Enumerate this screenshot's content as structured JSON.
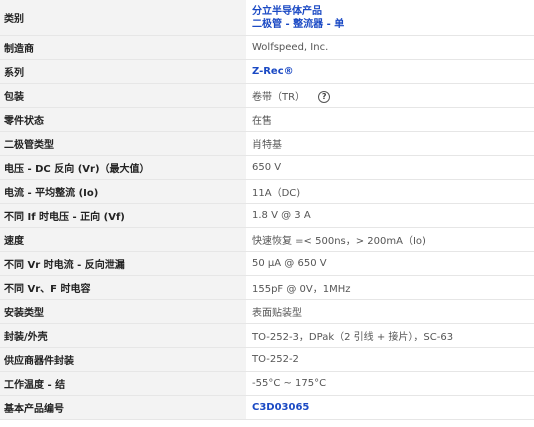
{
  "rows": [
    {
      "label": "类别",
      "value_line1": "分立半导体产品",
      "value_line2": "二极管 - 整流器 - 单"
    },
    {
      "label": "制造商",
      "value": "Wolfspeed, Inc."
    },
    {
      "label": "系列",
      "value": "Z-Rec®"
    },
    {
      "label": "包装",
      "value": "卷带（TR）",
      "icon": "help-circle-icon"
    },
    {
      "label": "零件状态",
      "value": "在售"
    },
    {
      "label": "二极管类型",
      "value": "肖特基"
    },
    {
      "label": "电压 - DC 反向 (Vr)（最大值）",
      "value": "650 V"
    },
    {
      "label": "电流 - 平均整流 (Io)",
      "value": "11A（DC)"
    },
    {
      "label": "不同 If 时电压 - 正向 (Vf)",
      "value": "1.8 V @ 3 A"
    },
    {
      "label": "速度",
      "value": "快速恢复 =< 500ns，> 200mA（Io)"
    },
    {
      "label": "不同 Vr 时电流 - 反向泄漏",
      "value": "50 µA @ 650 V"
    },
    {
      "label": "不同 Vr、F 时电容",
      "value": "155pF @ 0V，1MHz"
    },
    {
      "label": "安装类型",
      "value": "表面贴装型"
    },
    {
      "label": "封装/外壳",
      "value": "TO-252-3，DPak（2 引线 + 接片），SC-63"
    },
    {
      "label": "供应商器件封装",
      "value": "TO-252-2"
    },
    {
      "label": "工作温度 - 结",
      "value": "-55°C ~ 175°C"
    },
    {
      "label": "基本产品编号",
      "value": "C3D03065"
    }
  ],
  "colors": {
    "link": "#1a49c4",
    "key_bg": "#f3f3f3",
    "border": "#e6e6e6"
  }
}
